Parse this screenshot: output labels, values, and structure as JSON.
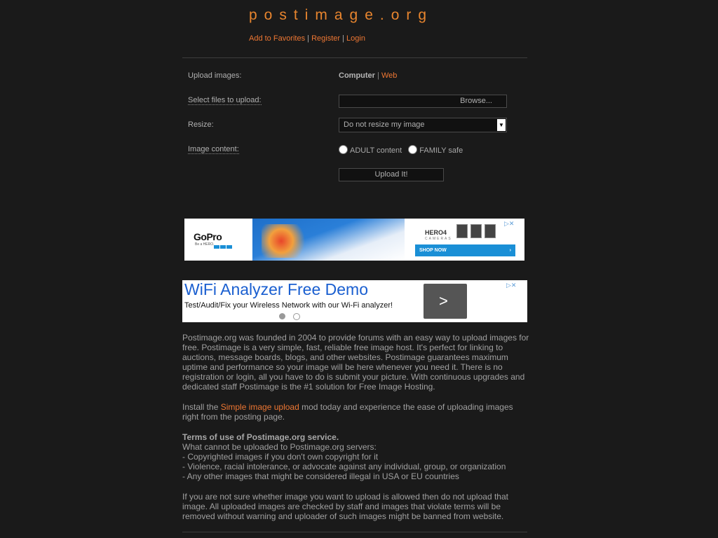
{
  "header": {
    "logo": "postimage.org",
    "links": [
      "Add to Favorites",
      "Register",
      "Login"
    ],
    "separator": "|"
  },
  "form": {
    "upload_label": "Upload images:",
    "source_computer": "Computer",
    "source_sep": "|",
    "source_web": "Web",
    "select_label": "Select files to upload:",
    "browse_label": "Browse...",
    "resize_label": "Resize:",
    "resize_value": "Do not resize my image",
    "content_label": "Image content:",
    "adult_label": "ADULT content",
    "family_label": "FAMILY safe",
    "upload_button": "Upload It!"
  },
  "ad1": {
    "brand": "GoPro",
    "brand_sub": "Be a HERO.",
    "product": "HERO4",
    "product_sub": "CAMERAS",
    "cta": "SHOP NOW",
    "cta_arrow": "›",
    "adchoice": "▷✕"
  },
  "ad2": {
    "headline": "WiFi Analyzer Free Demo",
    "description": "Test/Audit/Fix your Wireless Network with our Wi-Fi analyzer!",
    "arrow": ">",
    "adchoice": "▷✕"
  },
  "content": {
    "about": "Postimage.org was founded in 2004 to provide forums with an easy way to upload images for free. Postimage is a very simple, fast, reliable free image host. It's perfect for linking to auctions, message boards, blogs, and other websites. Postimage guarantees maximum uptime and performance so your image will be here whenever you need it. There is no registration or login, all you have to do is submit your picture. With continuous upgrades and dedicated staff Postimage is the #1 solution for Free Image Hosting.",
    "install_pre": "Install the ",
    "install_link": "Simple image upload",
    "install_post": " mod today and experience the ease of uploading images right from the posting page.",
    "terms_title": "Terms of use of Postimage.org service.",
    "terms_intro": "What cannot be uploaded to Postimage.org servers:",
    "terms_items": [
      "- Copyrighted images if you don't own copyright for it",
      "- Violence, racial intolerance, or advocate against any individual, group, or organization",
      "- Any other images that might be considered illegal in USA or EU countries"
    ],
    "disclaimer": "If you are not sure whether image you want to upload is allowed then do not upload that image. All uploaded images are checked by staff and images that violate terms will be removed without warning and uploader of such images might be banned from website."
  },
  "colors": {
    "background": "#1a1a1a",
    "accent": "#ee7733",
    "text": "#a8a8a8"
  }
}
